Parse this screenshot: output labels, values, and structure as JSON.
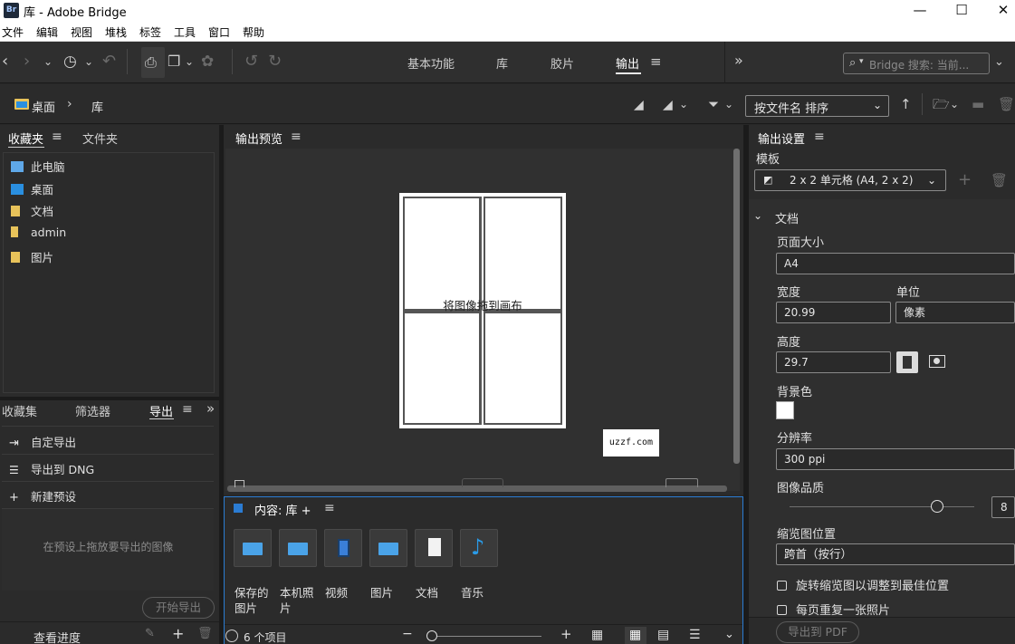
{
  "window": {
    "app_icon": "Br",
    "title": "库 - Adobe Bridge",
    "minimize": "—",
    "maximize": "☐",
    "close": "✕"
  },
  "menu": [
    "文件",
    "编辑",
    "视图",
    "堆栈",
    "标签",
    "工具",
    "窗口",
    "帮助"
  ],
  "workspaces": [
    {
      "label": "基本功能",
      "active": false
    },
    {
      "label": "库",
      "active": false
    },
    {
      "label": "胶片",
      "active": false
    },
    {
      "label": "输出",
      "active": true
    }
  ],
  "workspace_menu_icon": "≡",
  "more_workspaces": "»",
  "search": {
    "placeholder": "Bridge 搜索: 当前..."
  },
  "breadcrumb": {
    "root": "桌面",
    "separator": "›",
    "current": "库"
  },
  "sort": {
    "label": "按文件名 排序"
  },
  "left_top_tabs": [
    {
      "label": "收藏夹",
      "active": true
    },
    {
      "label": "文件夹",
      "active": false
    }
  ],
  "favorites": [
    {
      "label": "此电脑",
      "icon": "computer-icon",
      "color": "#5fa8e8"
    },
    {
      "label": "桌面",
      "icon": "desktop-icon",
      "color": "#2a8fe0"
    },
    {
      "label": "文档",
      "icon": "documents-icon",
      "color": "#e8c35a"
    },
    {
      "label": "admin",
      "icon": "user-folder-icon",
      "color": "#e8c35a"
    },
    {
      "label": "图片",
      "icon": "pictures-icon",
      "color": "#e8c35a"
    }
  ],
  "left_bottom_tabs": [
    {
      "label": "收藏集",
      "active": false
    },
    {
      "label": "筛选器",
      "active": false
    },
    {
      "label": "导出",
      "active": true
    }
  ],
  "export_items": [
    {
      "label": "自定导出",
      "glyph": "⇥"
    },
    {
      "label": "导出到 DNG",
      "glyph": "☰"
    },
    {
      "label": "新建预设",
      "glyph": "+"
    }
  ],
  "export_hint": "在预设上拖放要导出的图像",
  "start_export": "开始导出",
  "view_progress": "查看进度",
  "preview": {
    "title": "输出预览",
    "drop_hint": "将图像拖到画布",
    "watermark": "uzzf.com"
  },
  "content": {
    "title": "内容: 库 +",
    "items": [
      {
        "label": "保存的图片",
        "icon": "saved-pictures-icon"
      },
      {
        "label": "本机照片",
        "icon": "camera-roll-icon"
      },
      {
        "label": "视频",
        "icon": "videos-icon"
      },
      {
        "label": "图片",
        "icon": "pictures-library-icon"
      },
      {
        "label": "文档",
        "icon": "documents-library-icon"
      },
      {
        "label": "音乐",
        "icon": "music-icon"
      }
    ],
    "count": "6 个项目"
  },
  "settings": {
    "title": "输出设置",
    "template_label": "模板",
    "template_value": "2 x 2 单元格 (A4, 2 x 2)",
    "section_document": "文档",
    "page_size_label": "页面大小",
    "page_size_value": "A4",
    "width_label": "宽度",
    "width_value": "20.99",
    "unit_label": "单位",
    "unit_value": "像素",
    "height_label": "高度",
    "height_value": "29.7",
    "bg_label": "背景色",
    "bg_color": "#ffffff",
    "resolution_label": "分辨率",
    "resolution_value": "300 ppi",
    "quality_label": "图像品质",
    "quality_value": "8",
    "quality_fraction": 0.8,
    "thumb_pos_label": "缩览图位置",
    "thumb_pos_value": "跨首（按行）",
    "rotate_label": "旋转缩览图以调整到最佳位置",
    "repeat_label": "每页重复一张照片",
    "export_pdf": "导出到 PDF"
  },
  "colors": {
    "accent_blue": "#2b7cd3",
    "panel_bg": "#2b2b2b",
    "toolbar_bg": "#2f2f2f"
  }
}
